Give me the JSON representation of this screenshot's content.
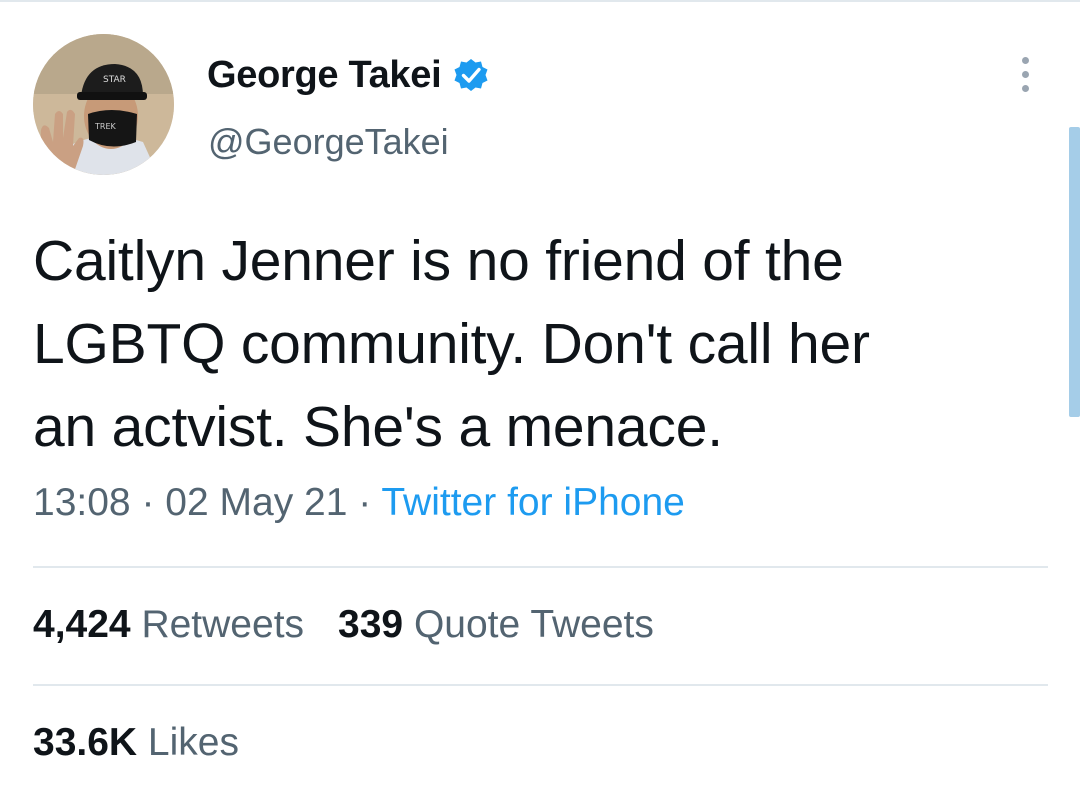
{
  "author": {
    "display_name": "George Takei",
    "handle": "@GeorgeTakei",
    "verified": true,
    "avatar_icon": "profile-photo"
  },
  "tweet": {
    "text_lines": [
      "Caitlyn Jenner is no friend of the",
      "LGBTQ community. Don't call her",
      "an actvist. She's a menace."
    ],
    "time": "13:08",
    "separator": "·",
    "date": "02 May 21",
    "source": "Twitter for iPhone"
  },
  "stats": {
    "retweets_count": "4,424",
    "retweets_label": "Retweets",
    "quote_count": "339",
    "quote_label": "Quote Tweets",
    "likes_count": "33.6K",
    "likes_label": "Likes"
  },
  "colors": {
    "link": "#1d9bf0",
    "verified_badge": "#1d9bf0",
    "secondary_text": "#536471",
    "primary_text": "#0f1419"
  },
  "icons": {
    "more": "more-vertical-icon",
    "verified": "verified-badge-icon"
  }
}
